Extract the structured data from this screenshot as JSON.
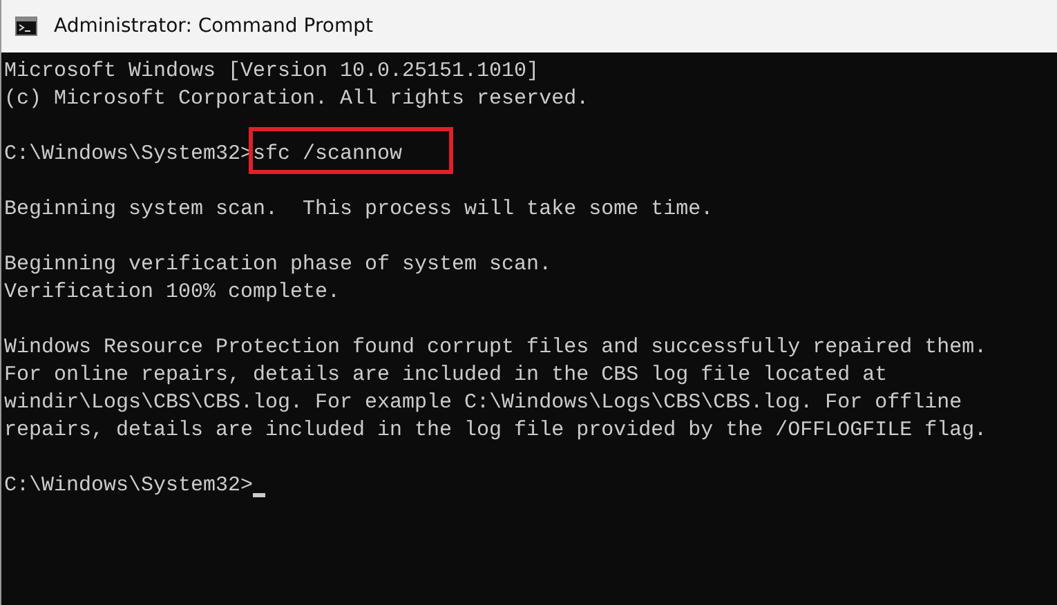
{
  "window": {
    "title": "Administrator: Command Prompt"
  },
  "console": {
    "lines": [
      {
        "kind": "text",
        "text": "Microsoft Windows [Version 10.0.25151.1010]"
      },
      {
        "kind": "text",
        "text": "(c) Microsoft Corporation. All rights reserved."
      },
      {
        "kind": "blank"
      },
      {
        "kind": "prompt",
        "prompt": "C:\\Windows\\System32>",
        "command": "sfc /scannow",
        "highlighted": true,
        "cursor": false
      },
      {
        "kind": "blank"
      },
      {
        "kind": "text",
        "text": "Beginning system scan.  This process will take some time."
      },
      {
        "kind": "blank"
      },
      {
        "kind": "text",
        "text": "Beginning verification phase of system scan."
      },
      {
        "kind": "text",
        "text": "Verification 100% complete."
      },
      {
        "kind": "blank"
      },
      {
        "kind": "text",
        "text": "Windows Resource Protection found corrupt files and successfully repaired them."
      },
      {
        "kind": "text",
        "text": "For online repairs, details are included in the CBS log file located at"
      },
      {
        "kind": "text",
        "text": "windir\\Logs\\CBS\\CBS.log. For example C:\\Windows\\Logs\\CBS\\CBS.log. For offline"
      },
      {
        "kind": "text",
        "text": "repairs, details are included in the log file provided by the /OFFLOGFILE flag."
      },
      {
        "kind": "blank"
      },
      {
        "kind": "prompt",
        "prompt": "C:\\Windows\\System32>",
        "highlighted": false,
        "cursor": true
      }
    ]
  }
}
